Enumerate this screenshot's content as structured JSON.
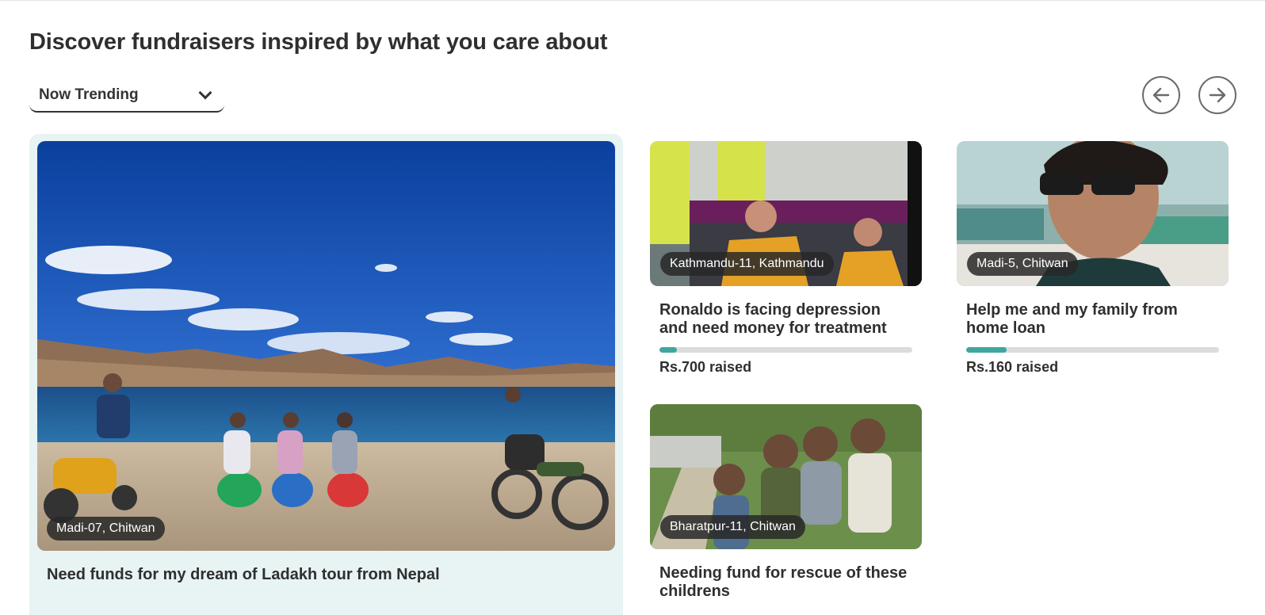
{
  "page": {
    "title": "Discover fundraisers inspired by what you care about"
  },
  "filter": {
    "selected": "Now Trending",
    "icon": "chevron-down-icon"
  },
  "nav": {
    "prev_icon": "arrow-left-icon",
    "next_icon": "arrow-right-icon"
  },
  "featured": {
    "location": "Madi-07, Chitwan",
    "title": "Need funds for my dream of Ladakh tour from Nepal"
  },
  "cards": [
    {
      "location": "Kathmandu-11, Kathmandu",
      "title": "Ronaldo is facing depression and need money for treatment",
      "raised": "Rs.700 raised",
      "progress": 0.07
    },
    {
      "location": "Madi-5, Chitwan",
      "title": "Help me and my family from home loan",
      "raised": "Rs.160 raised",
      "progress": 0.16
    },
    {
      "location": "Bharatpur-11, Chitwan",
      "title": "Needing fund for rescue of these childrens"
    }
  ],
  "colors": {
    "accent": "#3fa69f",
    "featured_bg": "#e8f3f3",
    "badge_bg": "#333333"
  }
}
